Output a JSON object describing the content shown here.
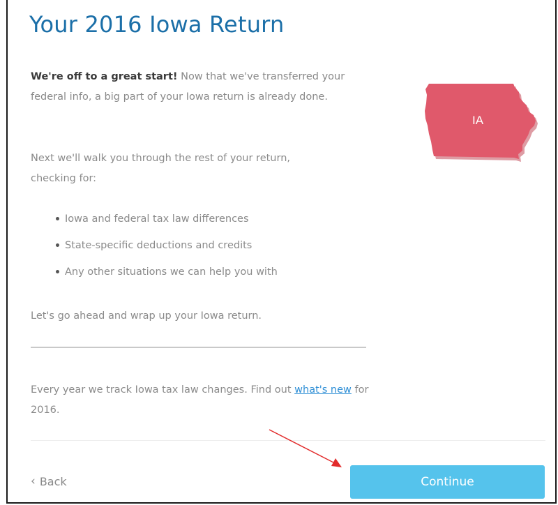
{
  "page": {
    "title": "Your 2016 Iowa Return",
    "intro_strong": "We're off to a great start!",
    "intro_rest": " Now that we've transferred your federal info, a big part of your Iowa return is already done.",
    "next_text": "Next we'll walk you through the rest of your return, checking for:",
    "bullets": [
      "Iowa and federal tax law differences",
      "State-specific deductions and credits",
      "Any other situations we can help you with"
    ],
    "wrap_text": "Let's go ahead and wrap up your Iowa return.",
    "year_prefix": "Every year we track Iowa tax law changes. Find out ",
    "year_link": "what's new",
    "year_suffix": " for 2016."
  },
  "map": {
    "state_abbr": "IA",
    "fill_color": "#e0596b"
  },
  "nav": {
    "back_label": "Back",
    "continue_label": "Continue",
    "continue_color": "#55c3ec"
  },
  "icons": {
    "back": "chevron-left-icon",
    "annotation": "red-arrow-annotation"
  }
}
